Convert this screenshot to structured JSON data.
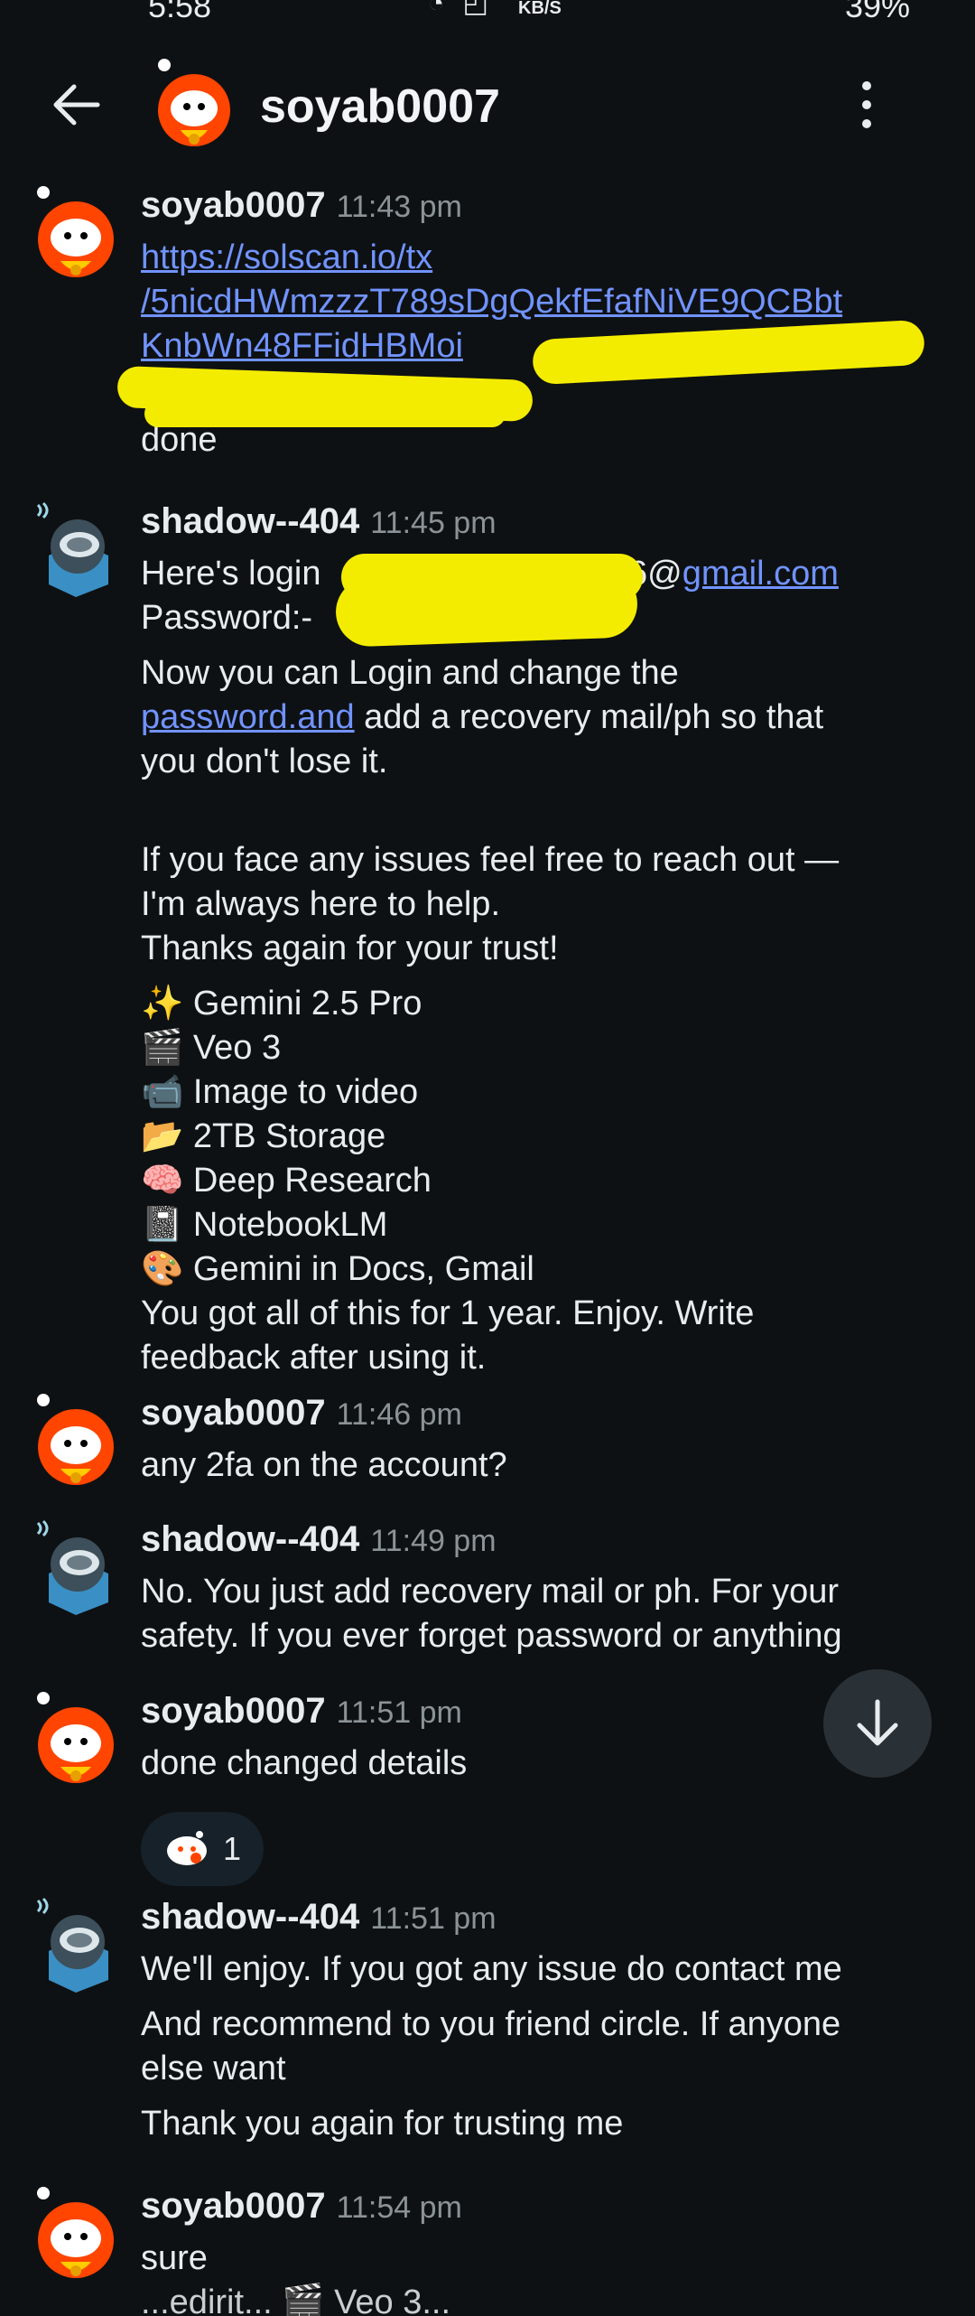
{
  "status_bar": {
    "time": "5:58",
    "kbs": "KB/S",
    "battery": "39%"
  },
  "header": {
    "title": "soyab0007"
  },
  "messages": [
    {
      "author": "soyab0007",
      "time": "11:43 pm",
      "link_lines": [
        "https://solscan.io/tx",
        "/5nicdHWmzzzT789sDgQekfEfafNiVE9QCBbt",
        "KnbWn48FFidHBMoi"
      ],
      "text": "done"
    },
    {
      "author": "shadow--404",
      "time": "11:45 pm",
      "login_label": "Here's login ",
      "login_suffix": "6@",
      "login_domain": "gmail.com",
      "password_label": "Password:- ",
      "p1_a": "Now you can Login and change the",
      "p1_link": "password.and",
      "p1_b": " add a recovery mail/ph so that",
      "p1_c": "you don't lose it.",
      "p2_a": " If you face any issues feel free to reach out —",
      "p2_b": "I'm always here to help.",
      "p2_c": "Thanks again for your trust!",
      "features": [
        {
          "emoji": "✨",
          "text": "Gemini 2.5 Pro"
        },
        {
          "emoji": "🎬",
          "text": "Veo 3"
        },
        {
          "emoji": "📹",
          "text": "Image to video"
        },
        {
          "emoji": "📂",
          "text": "2TB Storage"
        },
        {
          "emoji": "🧠",
          "text": "Deep Research"
        },
        {
          "emoji": "📓",
          "text": "NotebookLM"
        },
        {
          "emoji": "🎨",
          "text": "Gemini in Docs, Gmail"
        }
      ],
      "closing_a": "You got all of this for 1 year. Enjoy. Write",
      "closing_b": "feedback after using it."
    },
    {
      "author": "soyab0007",
      "time": "11:46 pm",
      "text": "any 2fa on the account?"
    },
    {
      "author": "shadow--404",
      "time": "11:49 pm",
      "line_a": "No. You just add recovery mail or ph. For your",
      "line_b": "safety. If you ever forget password or anything"
    },
    {
      "author": "soyab0007",
      "time": "11:51 pm",
      "text": "done changed details",
      "reaction_count": "1"
    },
    {
      "author": "shadow--404",
      "time": "11:51 pm",
      "line_a": "We'll enjoy. If you got any issue do contact me",
      "line_b": "And recommend to you friend circle. If anyone",
      "line_c": "else want",
      "line_d": "Thank you again for trusting me"
    },
    {
      "author": "soyab0007",
      "time": "11:54 pm",
      "text": "sure",
      "partial": "...edirit... 🎬 Veo 3..."
    }
  ],
  "colors": {
    "background": "#0e1113",
    "link": "#7193ff",
    "redaction": "#f3ec00",
    "timestamp": "#8b9398"
  },
  "icons": [
    "back-arrow-icon",
    "more-vertical-icon",
    "snoo-avatar-icon",
    "robot-avatar-icon",
    "arrow-down-icon"
  ]
}
